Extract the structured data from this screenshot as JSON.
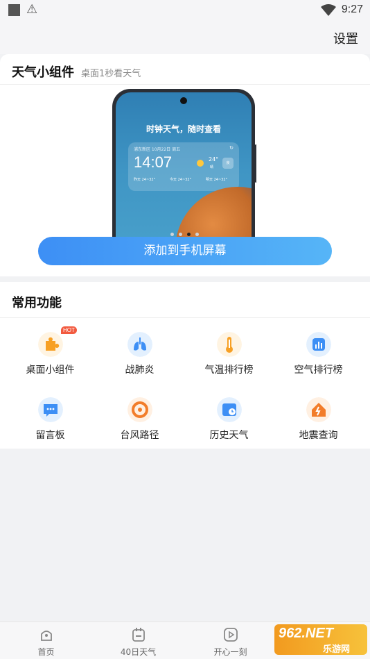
{
  "status_bar": {
    "time": "9:27"
  },
  "top_bar": {
    "settings_label": "设置"
  },
  "widget_card": {
    "title": "天气小组件",
    "subtitle": "桌面1秒看天气",
    "phone_preview": {
      "headline": "时钟天气，随时查看",
      "location": "浦东新区 10月22日 周五",
      "time": "14:07",
      "temperature": "24°",
      "condition": "晴",
      "aqi": "良",
      "forecast": [
        {
          "label": "昨天",
          "temp": "24~32°"
        },
        {
          "label": "今天",
          "temp": "24~32°"
        },
        {
          "label": "明天",
          "temp": "24~32°"
        }
      ]
    },
    "carousel": {
      "count": 4,
      "active_index": 2
    },
    "add_button_label": "添加到手机屏幕"
  },
  "functions_card": {
    "title": "常用功能",
    "hot_badge": "HOT",
    "items": [
      {
        "label": "桌面小组件",
        "icon": "puzzle-icon",
        "color": "#f7a024"
      },
      {
        "label": "战肺炎",
        "icon": "lungs-icon",
        "color": "#3d8ff5"
      },
      {
        "label": "气温排行榜",
        "icon": "thermometer-icon",
        "color": "#f7a024"
      },
      {
        "label": "空气排行榜",
        "icon": "air-chart-icon",
        "color": "#3d8ff5"
      },
      {
        "label": "留言板",
        "icon": "message-board-icon",
        "color": "#3d8ff5"
      },
      {
        "label": "台风路径",
        "icon": "typhoon-icon",
        "color": "#f27d2a"
      },
      {
        "label": "历史天气",
        "icon": "history-icon",
        "color": "#3d8ff5"
      },
      {
        "label": "地震查询",
        "icon": "earthquake-icon",
        "color": "#f27d2a"
      }
    ]
  },
  "tab_bar": {
    "tabs": [
      {
        "label": "首页",
        "icon": "home-icon"
      },
      {
        "label": "40日天气",
        "icon": "calendar-icon"
      },
      {
        "label": "开心一刻",
        "icon": "play-icon"
      }
    ]
  },
  "watermark": {
    "top": "962.NET",
    "bottom": "乐游网"
  }
}
